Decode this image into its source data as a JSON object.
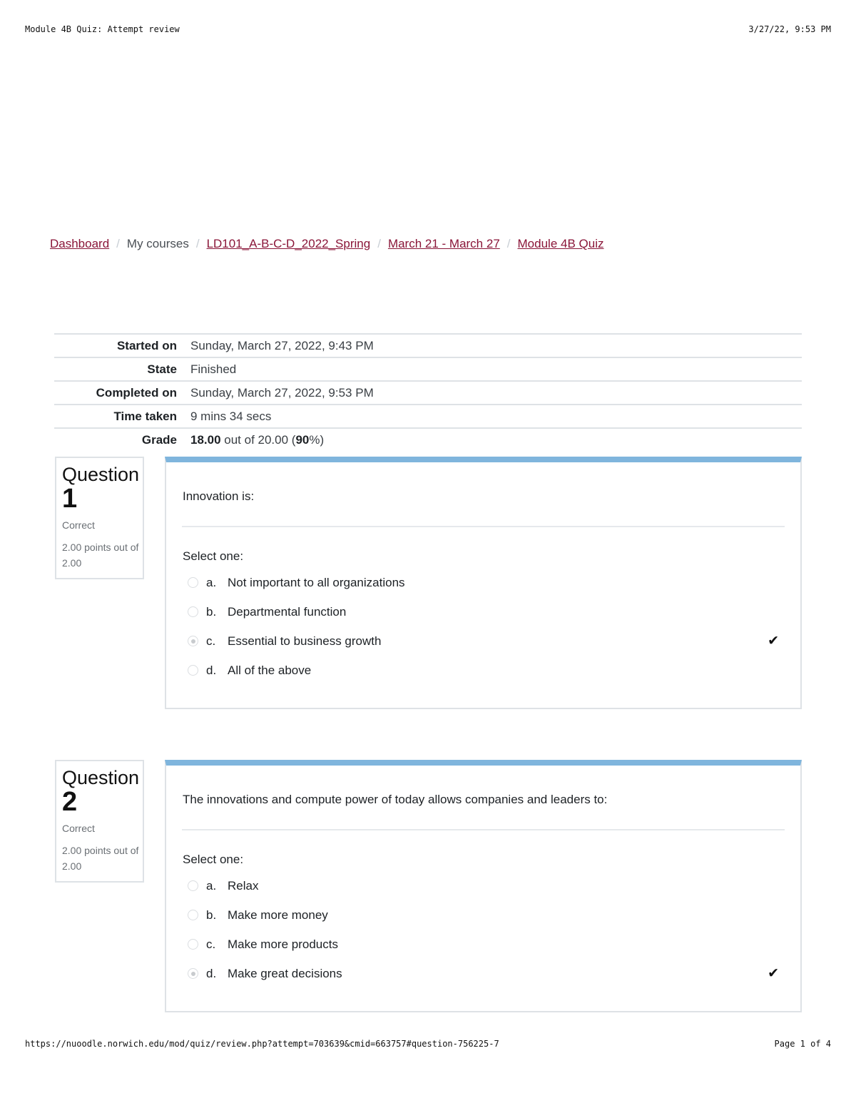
{
  "print_header": {
    "title": "Module 4B Quiz: Attempt review",
    "datetime": "3/27/22, 9:53 PM"
  },
  "breadcrumb": [
    {
      "label": "Dashboard",
      "link": true
    },
    {
      "label": "My courses",
      "link": false
    },
    {
      "label": "LD101_A-B-C-D_2022_Spring",
      "link": true
    },
    {
      "label": "March 21 - March 27",
      "link": true
    },
    {
      "label": "Module 4B Quiz",
      "link": true
    }
  ],
  "summary": {
    "started_on": {
      "label": "Started on",
      "value": "Sunday, March 27, 2022, 9:43 PM"
    },
    "state": {
      "label": "State",
      "value": "Finished"
    },
    "completed_on": {
      "label": "Completed on",
      "value": "Sunday, March 27, 2022, 9:53 PM"
    },
    "time_taken": {
      "label": "Time taken",
      "value": "9 mins 34 secs"
    },
    "grade": {
      "label": "Grade",
      "score": "18.00",
      "mid": " out of 20.00 (",
      "percent": "90",
      "end": "%)"
    }
  },
  "questions": [
    {
      "word": "Question",
      "number": "1",
      "state": "Correct",
      "grade": "2.00 points out of 2.00",
      "text": "Innovation is:",
      "prompt": "Select one:",
      "answers": [
        {
          "letter": "a.",
          "text": "Not important to all organizations",
          "selected": false
        },
        {
          "letter": "b.",
          "text": "Departmental function",
          "selected": false
        },
        {
          "letter": "c.",
          "text": "Essential to business growth",
          "selected": true,
          "mark": "✔"
        },
        {
          "letter": "d.",
          "text": "All of the above",
          "selected": false
        }
      ]
    },
    {
      "word": "Question",
      "number": "2",
      "state": "Correct",
      "grade": "2.00 points out of 2.00",
      "text": "The innovations and compute power of today allows companies and leaders to:",
      "prompt": "Select one:",
      "answers": [
        {
          "letter": "a.",
          "text": "Relax",
          "selected": false
        },
        {
          "letter": "b.",
          "text": "Make more money",
          "selected": false
        },
        {
          "letter": "c.",
          "text": "Make more products",
          "selected": false
        },
        {
          "letter": "d.",
          "text": "Make great decisions",
          "selected": true,
          "mark": "✔"
        }
      ]
    }
  ],
  "print_footer": {
    "url": "https://nuoodle.norwich.edu/mod/quiz/review.php?attempt=703639&cmid=663757#question-756225-7",
    "page": "Page 1 of 4"
  }
}
